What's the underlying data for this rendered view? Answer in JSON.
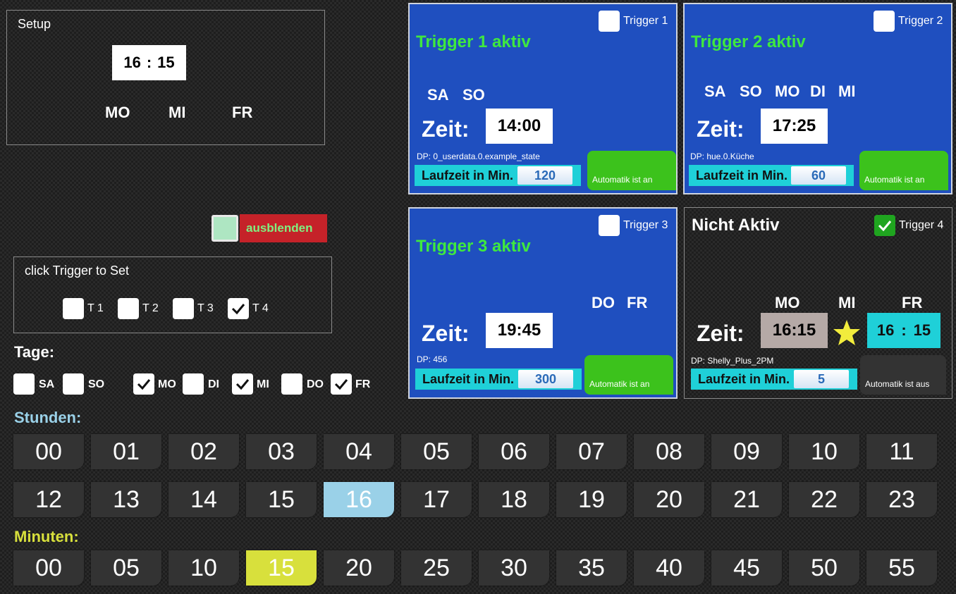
{
  "setup": {
    "title": "Setup",
    "hour": "16",
    "minute": "15",
    "sep": ":",
    "days": [
      "MO",
      "MI",
      "FR"
    ]
  },
  "triggers": [
    {
      "check_label": "Trigger 1",
      "checked": false,
      "title": "Trigger 1 aktiv",
      "days": [
        "SA",
        "SO"
      ],
      "zeit_label": "Zeit:",
      "time": "14:00",
      "dp": "DP: 0_userdata.0.example_state",
      "laufzeit_label": "Laufzeit in Min.",
      "laufzeit_value": "120",
      "auto_label": "Automatik ist an"
    },
    {
      "check_label": "Trigger 2",
      "checked": false,
      "title": "Trigger 2 aktiv",
      "days": [
        "SA",
        "SO",
        "MO",
        "DI",
        "MI"
      ],
      "zeit_label": "Zeit:",
      "time": "17:25",
      "dp": "DP: hue.0.Küche",
      "laufzeit_label": "Laufzeit in Min.",
      "laufzeit_value": "60",
      "auto_label": "Automatik ist an"
    },
    {
      "check_label": "Trigger 3",
      "checked": false,
      "title": "Trigger 3 aktiv",
      "days": [
        "DO",
        "FR"
      ],
      "zeit_label": "Zeit:",
      "time": "19:45",
      "dp": "DP: 456",
      "laufzeit_label": "Laufzeit in Min.",
      "laufzeit_value": "300",
      "auto_label": "Automatik ist an"
    },
    {
      "check_label": "Trigger 4",
      "checked": true,
      "title": "Nicht Aktiv",
      "days": [
        "MO",
        "MI",
        "FR"
      ],
      "zeit_label": "Zeit:",
      "time": "16:15",
      "edit_hour": "16",
      "edit_minute": "15",
      "edit_sep": ":",
      "dp": "DP: Shelly_Plus_2PM",
      "laufzeit_label": "Laufzeit in Min.",
      "laufzeit_value": "5",
      "auto_label": "Automatik ist aus"
    }
  ],
  "ausblenden": {
    "label": "ausblenden"
  },
  "click_trigger": {
    "title": "click Trigger to Set",
    "items": [
      {
        "label": "T 1",
        "checked": false
      },
      {
        "label": "T 2",
        "checked": false
      },
      {
        "label": "T 3",
        "checked": false
      },
      {
        "label": "T 4",
        "checked": true
      }
    ]
  },
  "tage": {
    "title": "Tage:",
    "days": [
      {
        "label": "SA",
        "checked": false
      },
      {
        "label": "SO",
        "checked": false
      },
      {
        "label": "MO",
        "checked": true
      },
      {
        "label": "DI",
        "checked": false
      },
      {
        "label": "MI",
        "checked": true
      },
      {
        "label": "DO",
        "checked": false
      },
      {
        "label": "FR",
        "checked": true
      }
    ]
  },
  "stunden": {
    "title": "Stunden:",
    "values": [
      "00",
      "01",
      "02",
      "03",
      "04",
      "05",
      "06",
      "07",
      "08",
      "09",
      "10",
      "11",
      "12",
      "13",
      "14",
      "15",
      "16",
      "17",
      "18",
      "19",
      "20",
      "21",
      "22",
      "23"
    ],
    "selected": "16"
  },
  "minuten": {
    "title": "Minuten:",
    "values": [
      "00",
      "05",
      "10",
      "15",
      "20",
      "25",
      "30",
      "35",
      "40",
      "45",
      "50",
      "55"
    ],
    "selected": "15"
  },
  "colors": {
    "card_blue": "#1f4fbf",
    "active_green": "#3fe83f",
    "laufzeit_cyan": "#1fd0d8",
    "stunden_blue": "#9ad1e8",
    "minuten_yellow": "#d8e03c",
    "ausblenden_red": "#c52229"
  }
}
